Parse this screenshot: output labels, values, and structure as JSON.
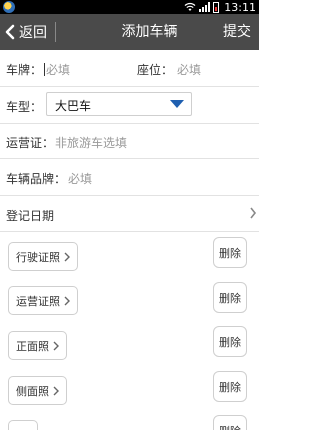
{
  "status_bar": {
    "time": "13:11"
  },
  "header": {
    "back_label": "返回",
    "title": "添加车辆",
    "submit_label": "提交"
  },
  "form": {
    "plate": {
      "label": "车牌：",
      "placeholder": "必填"
    },
    "seats": {
      "label": "座位：",
      "placeholder": "必填"
    },
    "car_type": {
      "label": "车型：",
      "value": "大巴车"
    },
    "license": {
      "label": "运营证：",
      "placeholder": "非旅游车选填"
    },
    "brand": {
      "label": "车辆品牌：",
      "placeholder": "必填"
    },
    "reg_date": {
      "label": "登记日期"
    }
  },
  "photos": [
    {
      "label": "行驶证照",
      "delete_label": "删除"
    },
    {
      "label": "运营证照",
      "delete_label": "删除"
    },
    {
      "label": "正面照",
      "delete_label": "删除"
    },
    {
      "label": "侧面照",
      "delete_label": "删除"
    },
    {
      "label": "",
      "delete_label": "删除"
    }
  ]
}
